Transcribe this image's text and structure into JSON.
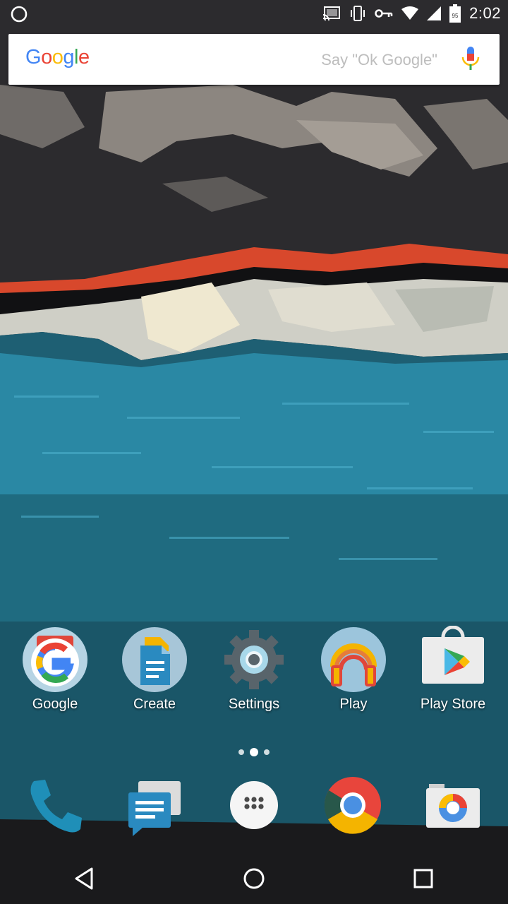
{
  "status_bar": {
    "time": "2:02",
    "battery_level": "95",
    "icons": [
      "notification-circle-icon",
      "cast-icon",
      "vibrate-icon",
      "vpn-key-icon",
      "wifi-icon",
      "cell-signal-icon",
      "battery-icon"
    ]
  },
  "search": {
    "logo_letters": [
      "G",
      "o",
      "o",
      "g",
      "l",
      "e"
    ],
    "logo_colors": [
      "#4285f4",
      "#ea4335",
      "#fbbc05",
      "#4285f4",
      "#34a853",
      "#ea4335"
    ],
    "hint": "Say \"Ok Google\""
  },
  "apps": [
    {
      "label": "Google",
      "icon": "google-icon"
    },
    {
      "label": "Create",
      "icon": "docs-create-icon"
    },
    {
      "label": "Settings",
      "icon": "settings-gear-icon"
    },
    {
      "label": "Play",
      "icon": "play-music-icon"
    },
    {
      "label": "Play Store",
      "icon": "play-store-icon"
    }
  ],
  "dock": [
    {
      "icon": "phone-icon"
    },
    {
      "icon": "messenger-icon"
    },
    {
      "icon": "app-drawer-icon"
    },
    {
      "icon": "chrome-icon"
    },
    {
      "icon": "camera-icon"
    }
  ],
  "nav": [
    "back-icon",
    "home-icon",
    "recents-icon"
  ]
}
